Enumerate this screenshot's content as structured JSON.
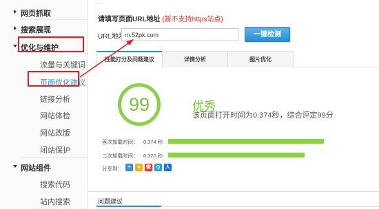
{
  "top_fragment": "...",
  "sidebar": {
    "sections": [
      {
        "label": "网页抓取"
      },
      {
        "label": "搜索展现"
      },
      {
        "label": "优化与维护"
      },
      {
        "label": "网站组件"
      }
    ],
    "items": [
      {
        "label": "流量与关键词"
      },
      {
        "label": "页面优化建议"
      },
      {
        "label": "链接分析"
      },
      {
        "label": "网站体检"
      },
      {
        "label": "网站改版"
      },
      {
        "label": "闭站保护"
      },
      {
        "label": "搜索代码"
      },
      {
        "label": "站内搜索"
      }
    ]
  },
  "form": {
    "hint": "请填写页面URL地址",
    "hint_note": "(暂不支持https站点)",
    "url_label": "URL地址",
    "url_value": "m.52pk.com",
    "check_button": "一键检测"
  },
  "tabs": [
    {
      "label": "性能打分及问题建议"
    },
    {
      "label": "详情分析"
    },
    {
      "label": "图片优化"
    }
  ],
  "result": {
    "score": "99",
    "grade": "优秀",
    "summary": "该页面打开时间为0.374秒，综合评定99分",
    "first_load_label": "首次加载时间：",
    "first_load_value": "0.374 秒",
    "first_load_fraction": 0.82,
    "second_load_label": "二次加载时间：",
    "second_load_value": "0.325 秒",
    "second_load_fraction": 0.72,
    "share_label": "分享到：",
    "share_icons": [
      "plus-icon",
      "star-icon",
      "weibo-icon",
      "qq-icon",
      "renren-icon"
    ]
  },
  "issues": {
    "title": "问题建议"
  },
  "colors": {
    "accent": "#2b8fd6",
    "good": "#7cc43e",
    "highlight": "#e02020"
  }
}
